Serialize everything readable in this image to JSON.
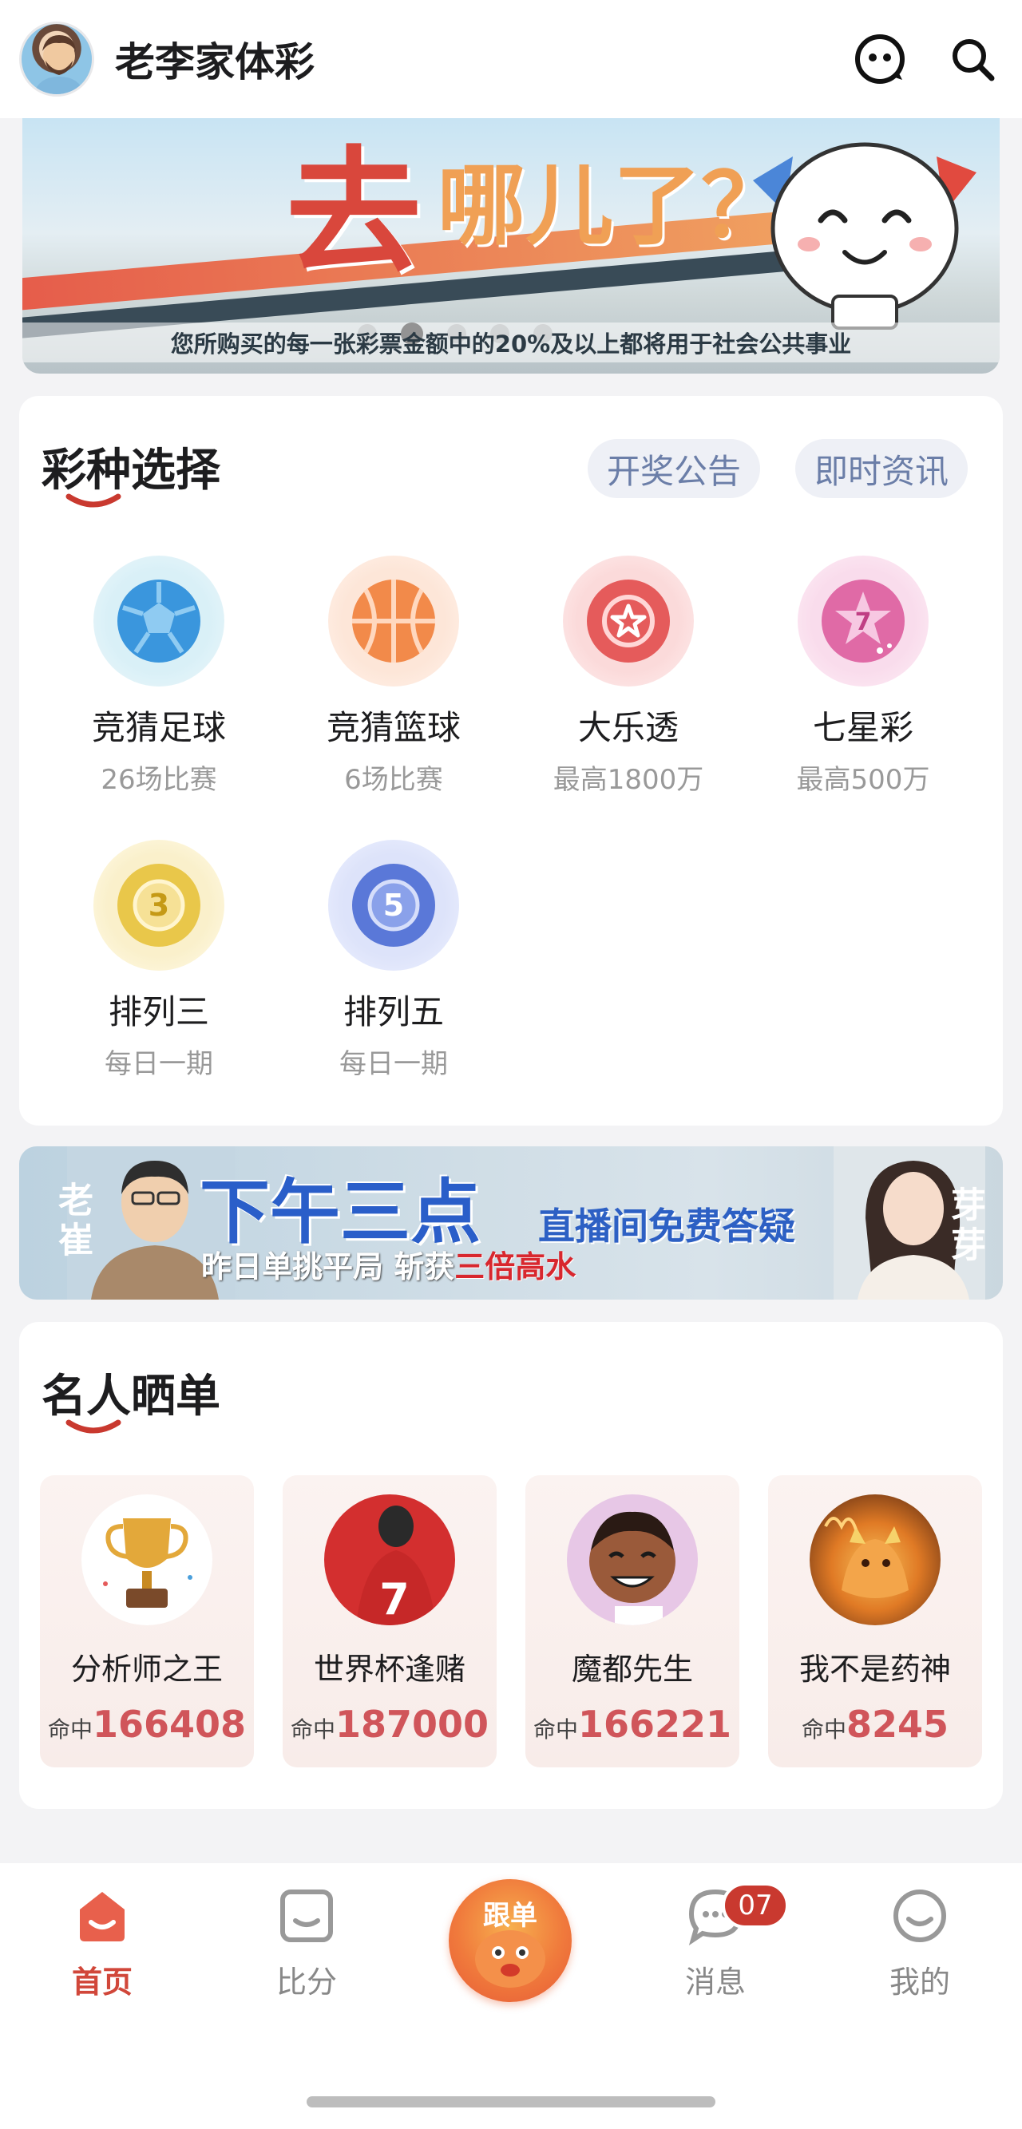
{
  "header": {
    "title": "老李家体彩",
    "avatar_icon": "user-avatar",
    "service_icon": "customer-service-icon",
    "search_icon": "search-icon"
  },
  "banner": {
    "headline_main": "去",
    "headline_tail": "哪儿了？",
    "caption": "您所购买的每一张彩票金额中的20%及以上都将用于社会公共事业",
    "slide_count": 5,
    "active_slide": 2
  },
  "lottery": {
    "title": "彩种选择",
    "pills": [
      "开奖公告",
      "即时资讯"
    ],
    "items": [
      {
        "name": "竞猜足球",
        "sub": "26场比赛",
        "icon": "football-icon",
        "color": "#4a9fdc"
      },
      {
        "name": "竞猜篮球",
        "sub": "6场比赛",
        "icon": "basketball-icon",
        "color": "#f08c4e"
      },
      {
        "name": "大乐透",
        "sub": "最高1800万",
        "icon": "star-ball-icon",
        "color": "#e55b5b"
      },
      {
        "name": "七星彩",
        "sub": "最高500万",
        "icon": "seven-star-icon",
        "color": "#e06aa6"
      },
      {
        "name": "排列三",
        "sub": "每日一期",
        "icon": "number-3-ball-icon",
        "color": "#e8c54a"
      },
      {
        "name": "排列五",
        "sub": "每日一期",
        "icon": "number-5-ball-icon",
        "color": "#5a78d8"
      }
    ]
  },
  "promo": {
    "left_name": "老崔",
    "right_name": "芽芽",
    "headline": "下午三点",
    "subline": "直播间免费答疑",
    "bottom_text": "昨日单挑平局 斩获",
    "bottom_highlight": "三倍高水"
  },
  "celebrities": {
    "title": "名人晒单",
    "hit_label": "命中",
    "items": [
      {
        "name": "分析师之王",
        "hit": "166408",
        "avatar": "trophy-avatar"
      },
      {
        "name": "世界杯逢赌",
        "hit": "187000",
        "avatar": "football-player-avatar"
      },
      {
        "name": "魔都先生",
        "hit": "166221",
        "avatar": "cartoon-avatar"
      },
      {
        "name": "我不是药神",
        "hit": "8245",
        "avatar": "fire-animal-avatar"
      }
    ]
  },
  "nav": {
    "items": [
      {
        "label": "首页",
        "icon": "home-icon",
        "active": true
      },
      {
        "label": "比分",
        "icon": "score-icon",
        "active": false
      },
      {
        "label": "跟单",
        "icon": "follow-mascot-icon",
        "active": false
      },
      {
        "label": "消息",
        "icon": "message-icon",
        "active": false
      },
      {
        "label": "我的",
        "icon": "profile-icon",
        "active": false
      }
    ],
    "message_badge": "07",
    "accent": "#d1473a"
  }
}
